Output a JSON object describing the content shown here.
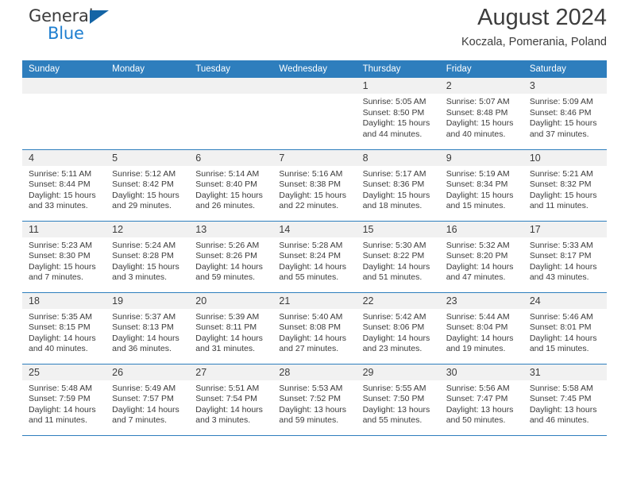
{
  "brand": {
    "name_part1": "General",
    "name_part2": "Blue",
    "mark": "triangle-flag"
  },
  "header": {
    "title": "August 2024",
    "location": "Koczala, Pomerania, Poland"
  },
  "calendar": {
    "weekday_headers": [
      "Sunday",
      "Monday",
      "Tuesday",
      "Wednesday",
      "Thursday",
      "Friday",
      "Saturday"
    ],
    "accent_color": "#2e7ebd",
    "daynum_bg": "#f1f1f1",
    "labels": {
      "sunrise": "Sunrise:",
      "sunset": "Sunset:",
      "daylight": "Daylight:"
    },
    "weeks": [
      [
        {
          "day": "",
          "sunrise": "",
          "sunset": "",
          "daylight": ""
        },
        {
          "day": "",
          "sunrise": "",
          "sunset": "",
          "daylight": ""
        },
        {
          "day": "",
          "sunrise": "",
          "sunset": "",
          "daylight": ""
        },
        {
          "day": "",
          "sunrise": "",
          "sunset": "",
          "daylight": ""
        },
        {
          "day": "1",
          "sunrise": "Sunrise: 5:05 AM",
          "sunset": "Sunset: 8:50 PM",
          "daylight": "Daylight: 15 hours and 44 minutes."
        },
        {
          "day": "2",
          "sunrise": "Sunrise: 5:07 AM",
          "sunset": "Sunset: 8:48 PM",
          "daylight": "Daylight: 15 hours and 40 minutes."
        },
        {
          "day": "3",
          "sunrise": "Sunrise: 5:09 AM",
          "sunset": "Sunset: 8:46 PM",
          "daylight": "Daylight: 15 hours and 37 minutes."
        }
      ],
      [
        {
          "day": "4",
          "sunrise": "Sunrise: 5:11 AM",
          "sunset": "Sunset: 8:44 PM",
          "daylight": "Daylight: 15 hours and 33 minutes."
        },
        {
          "day": "5",
          "sunrise": "Sunrise: 5:12 AM",
          "sunset": "Sunset: 8:42 PM",
          "daylight": "Daylight: 15 hours and 29 minutes."
        },
        {
          "day": "6",
          "sunrise": "Sunrise: 5:14 AM",
          "sunset": "Sunset: 8:40 PM",
          "daylight": "Daylight: 15 hours and 26 minutes."
        },
        {
          "day": "7",
          "sunrise": "Sunrise: 5:16 AM",
          "sunset": "Sunset: 8:38 PM",
          "daylight": "Daylight: 15 hours and 22 minutes."
        },
        {
          "day": "8",
          "sunrise": "Sunrise: 5:17 AM",
          "sunset": "Sunset: 8:36 PM",
          "daylight": "Daylight: 15 hours and 18 minutes."
        },
        {
          "day": "9",
          "sunrise": "Sunrise: 5:19 AM",
          "sunset": "Sunset: 8:34 PM",
          "daylight": "Daylight: 15 hours and 15 minutes."
        },
        {
          "day": "10",
          "sunrise": "Sunrise: 5:21 AM",
          "sunset": "Sunset: 8:32 PM",
          "daylight": "Daylight: 15 hours and 11 minutes."
        }
      ],
      [
        {
          "day": "11",
          "sunrise": "Sunrise: 5:23 AM",
          "sunset": "Sunset: 8:30 PM",
          "daylight": "Daylight: 15 hours and 7 minutes."
        },
        {
          "day": "12",
          "sunrise": "Sunrise: 5:24 AM",
          "sunset": "Sunset: 8:28 PM",
          "daylight": "Daylight: 15 hours and 3 minutes."
        },
        {
          "day": "13",
          "sunrise": "Sunrise: 5:26 AM",
          "sunset": "Sunset: 8:26 PM",
          "daylight": "Daylight: 14 hours and 59 minutes."
        },
        {
          "day": "14",
          "sunrise": "Sunrise: 5:28 AM",
          "sunset": "Sunset: 8:24 PM",
          "daylight": "Daylight: 14 hours and 55 minutes."
        },
        {
          "day": "15",
          "sunrise": "Sunrise: 5:30 AM",
          "sunset": "Sunset: 8:22 PM",
          "daylight": "Daylight: 14 hours and 51 minutes."
        },
        {
          "day": "16",
          "sunrise": "Sunrise: 5:32 AM",
          "sunset": "Sunset: 8:20 PM",
          "daylight": "Daylight: 14 hours and 47 minutes."
        },
        {
          "day": "17",
          "sunrise": "Sunrise: 5:33 AM",
          "sunset": "Sunset: 8:17 PM",
          "daylight": "Daylight: 14 hours and 43 minutes."
        }
      ],
      [
        {
          "day": "18",
          "sunrise": "Sunrise: 5:35 AM",
          "sunset": "Sunset: 8:15 PM",
          "daylight": "Daylight: 14 hours and 40 minutes."
        },
        {
          "day": "19",
          "sunrise": "Sunrise: 5:37 AM",
          "sunset": "Sunset: 8:13 PM",
          "daylight": "Daylight: 14 hours and 36 minutes."
        },
        {
          "day": "20",
          "sunrise": "Sunrise: 5:39 AM",
          "sunset": "Sunset: 8:11 PM",
          "daylight": "Daylight: 14 hours and 31 minutes."
        },
        {
          "day": "21",
          "sunrise": "Sunrise: 5:40 AM",
          "sunset": "Sunset: 8:08 PM",
          "daylight": "Daylight: 14 hours and 27 minutes."
        },
        {
          "day": "22",
          "sunrise": "Sunrise: 5:42 AM",
          "sunset": "Sunset: 8:06 PM",
          "daylight": "Daylight: 14 hours and 23 minutes."
        },
        {
          "day": "23",
          "sunrise": "Sunrise: 5:44 AM",
          "sunset": "Sunset: 8:04 PM",
          "daylight": "Daylight: 14 hours and 19 minutes."
        },
        {
          "day": "24",
          "sunrise": "Sunrise: 5:46 AM",
          "sunset": "Sunset: 8:01 PM",
          "daylight": "Daylight: 14 hours and 15 minutes."
        }
      ],
      [
        {
          "day": "25",
          "sunrise": "Sunrise: 5:48 AM",
          "sunset": "Sunset: 7:59 PM",
          "daylight": "Daylight: 14 hours and 11 minutes."
        },
        {
          "day": "26",
          "sunrise": "Sunrise: 5:49 AM",
          "sunset": "Sunset: 7:57 PM",
          "daylight": "Daylight: 14 hours and 7 minutes."
        },
        {
          "day": "27",
          "sunrise": "Sunrise: 5:51 AM",
          "sunset": "Sunset: 7:54 PM",
          "daylight": "Daylight: 14 hours and 3 minutes."
        },
        {
          "day": "28",
          "sunrise": "Sunrise: 5:53 AM",
          "sunset": "Sunset: 7:52 PM",
          "daylight": "Daylight: 13 hours and 59 minutes."
        },
        {
          "day": "29",
          "sunrise": "Sunrise: 5:55 AM",
          "sunset": "Sunset: 7:50 PM",
          "daylight": "Daylight: 13 hours and 55 minutes."
        },
        {
          "day": "30",
          "sunrise": "Sunrise: 5:56 AM",
          "sunset": "Sunset: 7:47 PM",
          "daylight": "Daylight: 13 hours and 50 minutes."
        },
        {
          "day": "31",
          "sunrise": "Sunrise: 5:58 AM",
          "sunset": "Sunset: 7:45 PM",
          "daylight": "Daylight: 13 hours and 46 minutes."
        }
      ]
    ]
  }
}
